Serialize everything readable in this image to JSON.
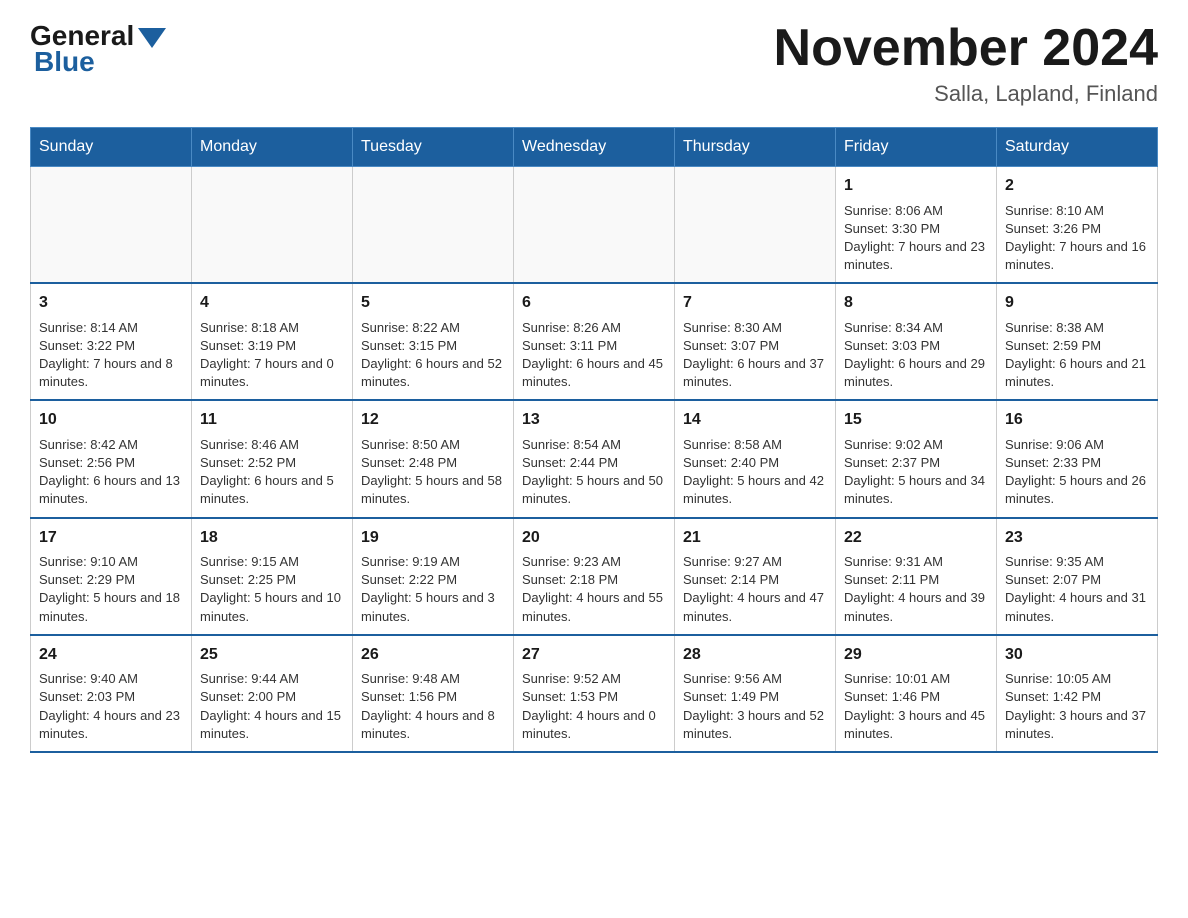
{
  "header": {
    "logo_general": "General",
    "logo_arrow": "",
    "logo_blue": "Blue",
    "month_title": "November 2024",
    "location": "Salla, Lapland, Finland"
  },
  "days_of_week": [
    "Sunday",
    "Monday",
    "Tuesday",
    "Wednesday",
    "Thursday",
    "Friday",
    "Saturday"
  ],
  "weeks": [
    [
      {
        "day": "",
        "info": ""
      },
      {
        "day": "",
        "info": ""
      },
      {
        "day": "",
        "info": ""
      },
      {
        "day": "",
        "info": ""
      },
      {
        "day": "",
        "info": ""
      },
      {
        "day": "1",
        "info": "Sunrise: 8:06 AM\nSunset: 3:30 PM\nDaylight: 7 hours and 23 minutes."
      },
      {
        "day": "2",
        "info": "Sunrise: 8:10 AM\nSunset: 3:26 PM\nDaylight: 7 hours and 16 minutes."
      }
    ],
    [
      {
        "day": "3",
        "info": "Sunrise: 8:14 AM\nSunset: 3:22 PM\nDaylight: 7 hours and 8 minutes."
      },
      {
        "day": "4",
        "info": "Sunrise: 8:18 AM\nSunset: 3:19 PM\nDaylight: 7 hours and 0 minutes."
      },
      {
        "day": "5",
        "info": "Sunrise: 8:22 AM\nSunset: 3:15 PM\nDaylight: 6 hours and 52 minutes."
      },
      {
        "day": "6",
        "info": "Sunrise: 8:26 AM\nSunset: 3:11 PM\nDaylight: 6 hours and 45 minutes."
      },
      {
        "day": "7",
        "info": "Sunrise: 8:30 AM\nSunset: 3:07 PM\nDaylight: 6 hours and 37 minutes."
      },
      {
        "day": "8",
        "info": "Sunrise: 8:34 AM\nSunset: 3:03 PM\nDaylight: 6 hours and 29 minutes."
      },
      {
        "day": "9",
        "info": "Sunrise: 8:38 AM\nSunset: 2:59 PM\nDaylight: 6 hours and 21 minutes."
      }
    ],
    [
      {
        "day": "10",
        "info": "Sunrise: 8:42 AM\nSunset: 2:56 PM\nDaylight: 6 hours and 13 minutes."
      },
      {
        "day": "11",
        "info": "Sunrise: 8:46 AM\nSunset: 2:52 PM\nDaylight: 6 hours and 5 minutes."
      },
      {
        "day": "12",
        "info": "Sunrise: 8:50 AM\nSunset: 2:48 PM\nDaylight: 5 hours and 58 minutes."
      },
      {
        "day": "13",
        "info": "Sunrise: 8:54 AM\nSunset: 2:44 PM\nDaylight: 5 hours and 50 minutes."
      },
      {
        "day": "14",
        "info": "Sunrise: 8:58 AM\nSunset: 2:40 PM\nDaylight: 5 hours and 42 minutes."
      },
      {
        "day": "15",
        "info": "Sunrise: 9:02 AM\nSunset: 2:37 PM\nDaylight: 5 hours and 34 minutes."
      },
      {
        "day": "16",
        "info": "Sunrise: 9:06 AM\nSunset: 2:33 PM\nDaylight: 5 hours and 26 minutes."
      }
    ],
    [
      {
        "day": "17",
        "info": "Sunrise: 9:10 AM\nSunset: 2:29 PM\nDaylight: 5 hours and 18 minutes."
      },
      {
        "day": "18",
        "info": "Sunrise: 9:15 AM\nSunset: 2:25 PM\nDaylight: 5 hours and 10 minutes."
      },
      {
        "day": "19",
        "info": "Sunrise: 9:19 AM\nSunset: 2:22 PM\nDaylight: 5 hours and 3 minutes."
      },
      {
        "day": "20",
        "info": "Sunrise: 9:23 AM\nSunset: 2:18 PM\nDaylight: 4 hours and 55 minutes."
      },
      {
        "day": "21",
        "info": "Sunrise: 9:27 AM\nSunset: 2:14 PM\nDaylight: 4 hours and 47 minutes."
      },
      {
        "day": "22",
        "info": "Sunrise: 9:31 AM\nSunset: 2:11 PM\nDaylight: 4 hours and 39 minutes."
      },
      {
        "day": "23",
        "info": "Sunrise: 9:35 AM\nSunset: 2:07 PM\nDaylight: 4 hours and 31 minutes."
      }
    ],
    [
      {
        "day": "24",
        "info": "Sunrise: 9:40 AM\nSunset: 2:03 PM\nDaylight: 4 hours and 23 minutes."
      },
      {
        "day": "25",
        "info": "Sunrise: 9:44 AM\nSunset: 2:00 PM\nDaylight: 4 hours and 15 minutes."
      },
      {
        "day": "26",
        "info": "Sunrise: 9:48 AM\nSunset: 1:56 PM\nDaylight: 4 hours and 8 minutes."
      },
      {
        "day": "27",
        "info": "Sunrise: 9:52 AM\nSunset: 1:53 PM\nDaylight: 4 hours and 0 minutes."
      },
      {
        "day": "28",
        "info": "Sunrise: 9:56 AM\nSunset: 1:49 PM\nDaylight: 3 hours and 52 minutes."
      },
      {
        "day": "29",
        "info": "Sunrise: 10:01 AM\nSunset: 1:46 PM\nDaylight: 3 hours and 45 minutes."
      },
      {
        "day": "30",
        "info": "Sunrise: 10:05 AM\nSunset: 1:42 PM\nDaylight: 3 hours and 37 minutes."
      }
    ]
  ]
}
